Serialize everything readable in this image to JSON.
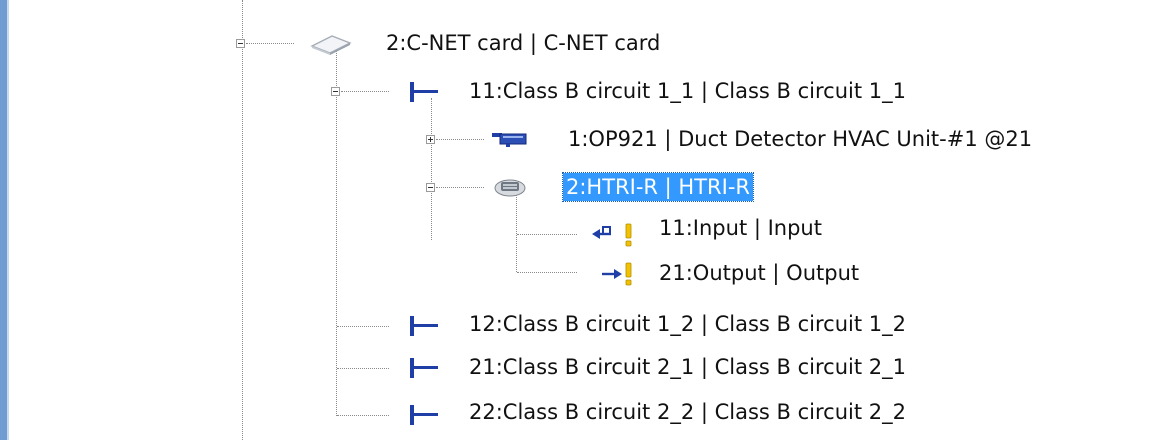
{
  "tree": {
    "card": {
      "label": "2:C-NET card | C-NET card",
      "icon": "card-icon",
      "expanded": true
    },
    "circuit_1_1": {
      "label": "11:Class B circuit 1_1 | Class B circuit 1_1",
      "icon": "circuit-icon",
      "expanded": true
    },
    "op921": {
      "label": "1:OP921 | Duct Detector HVAC Unit-#1 @21",
      "icon": "duct-detector-icon",
      "expanded": false
    },
    "htri": {
      "label": "2:HTRI-R | HTRI-R",
      "icon": "module-icon",
      "expanded": true,
      "selected": true
    },
    "input": {
      "label": "11:Input | Input",
      "icon": "input-warning-icon"
    },
    "output": {
      "label": "21:Output | Output",
      "icon": "output-warning-icon"
    },
    "circuit_1_2": {
      "label": "12:Class B circuit 1_2 | Class B circuit 1_2",
      "icon": "circuit-icon"
    },
    "circuit_2_1": {
      "label": "21:Class B circuit 2_1 | Class B circuit 2_1",
      "icon": "circuit-icon"
    },
    "circuit_2_2": {
      "label": "22:Class B circuit 2_2 | Class B circuit 2_2",
      "icon": "circuit-icon"
    }
  },
  "colors": {
    "selection": "#3399ff",
    "circuit_blue": "#1f3fa6",
    "warning_yellow": "#f2c200",
    "frame_blue": "#6f9dd1"
  }
}
